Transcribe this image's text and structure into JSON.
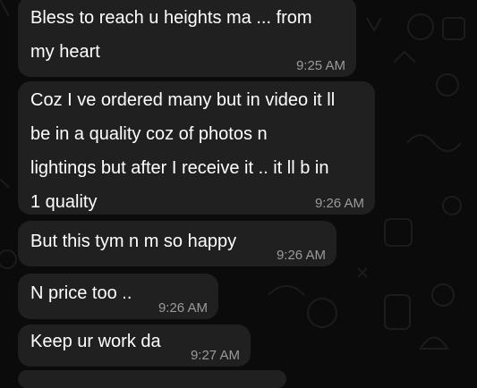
{
  "chat": {
    "messages": [
      {
        "text": "Bless to reach u heights ma ... from\nmy heart",
        "time": "9:25 AM"
      },
      {
        "text": "Coz I ve ordered many but in video it ll\nbe in a quality coz of photos n\nlightings but after I receive it .. it ll b in\n1 quality",
        "time": "9:26 AM"
      },
      {
        "text": "But this tym n m so happy",
        "time": "9:26 AM"
      },
      {
        "text": "N price too ..",
        "time": "9:26 AM"
      },
      {
        "text": "Keep ur work da",
        "time": "9:27 AM"
      }
    ]
  },
  "colors": {
    "background": "#0b0b0b",
    "bubble": "#202020",
    "text": "#ffffff",
    "timestamp": "#9a9a9a",
    "doodle": "#1b1b1b"
  }
}
